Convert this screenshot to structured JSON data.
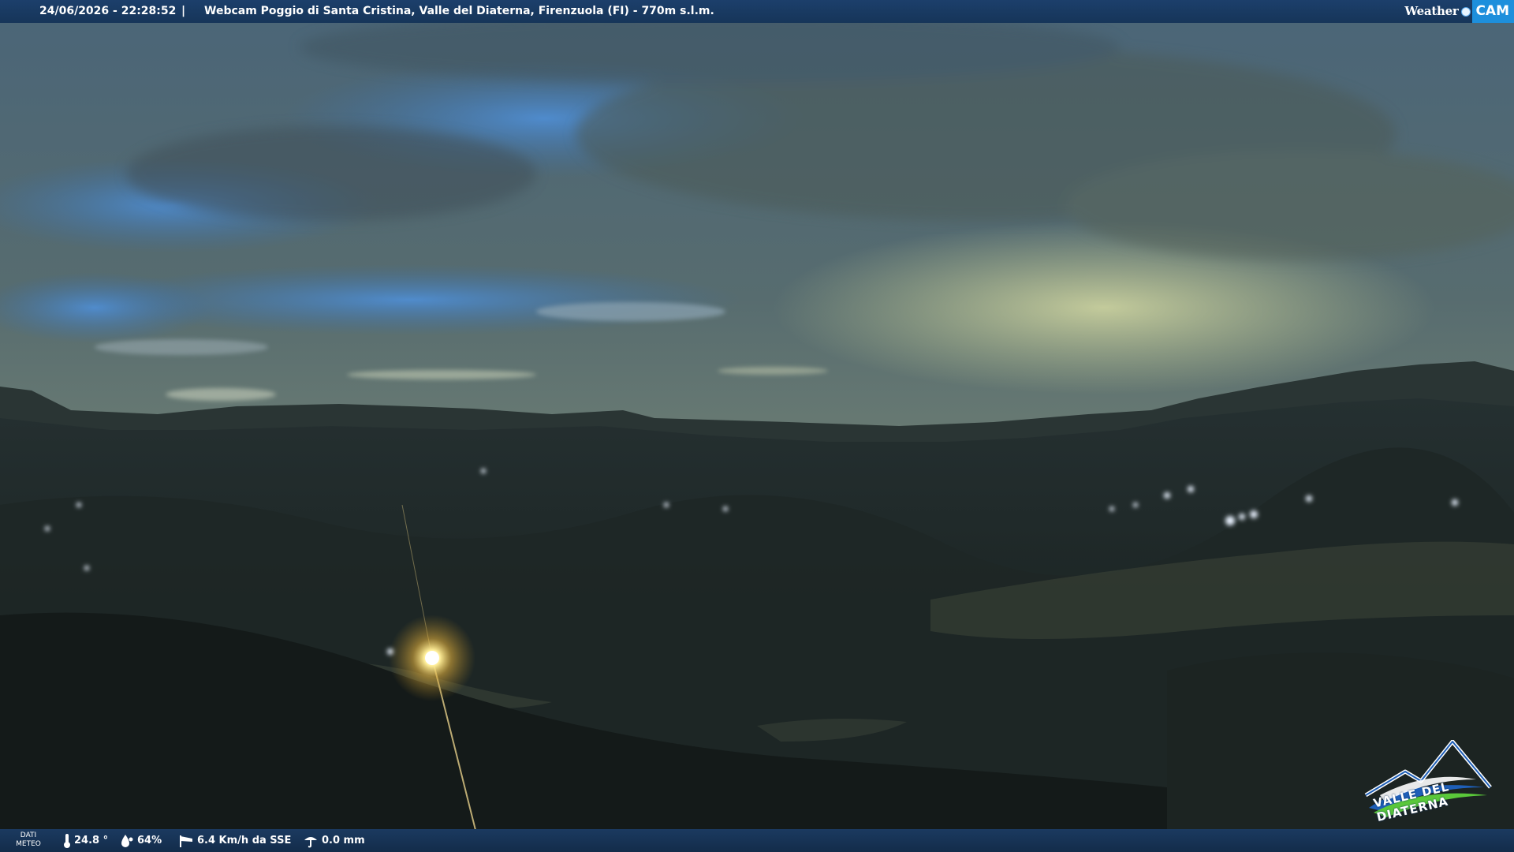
{
  "header": {
    "datetime": "24/06/2026 - 22:28:52",
    "separator": "|",
    "title": "Webcam Poggio di Santa Cristina, Valle del Diaterna, Firenzuola (FI) - 770m s.l.m.",
    "brand": {
      "prefix": "Weather",
      "suffix": "CAM"
    }
  },
  "footer": {
    "meteo_label_line1": "DATI",
    "meteo_label_line2": "METEO",
    "temperature": "24.8 °",
    "humidity": "64%",
    "wind": "6.4 Km/h da SSE",
    "rain": "0.0 mm",
    "icons": [
      "thermometer-icon",
      "humidity-drop-icon",
      "wind-sock-icon",
      "rain-gauge-icon"
    ]
  },
  "logo": {
    "text": "VALLE DEL DIATERNA"
  },
  "colors": {
    "bar": "#1a3a62",
    "brand_accent": "#1d8fdc",
    "logo_blue": "#1e5fb8",
    "logo_green": "#5ac83a"
  }
}
